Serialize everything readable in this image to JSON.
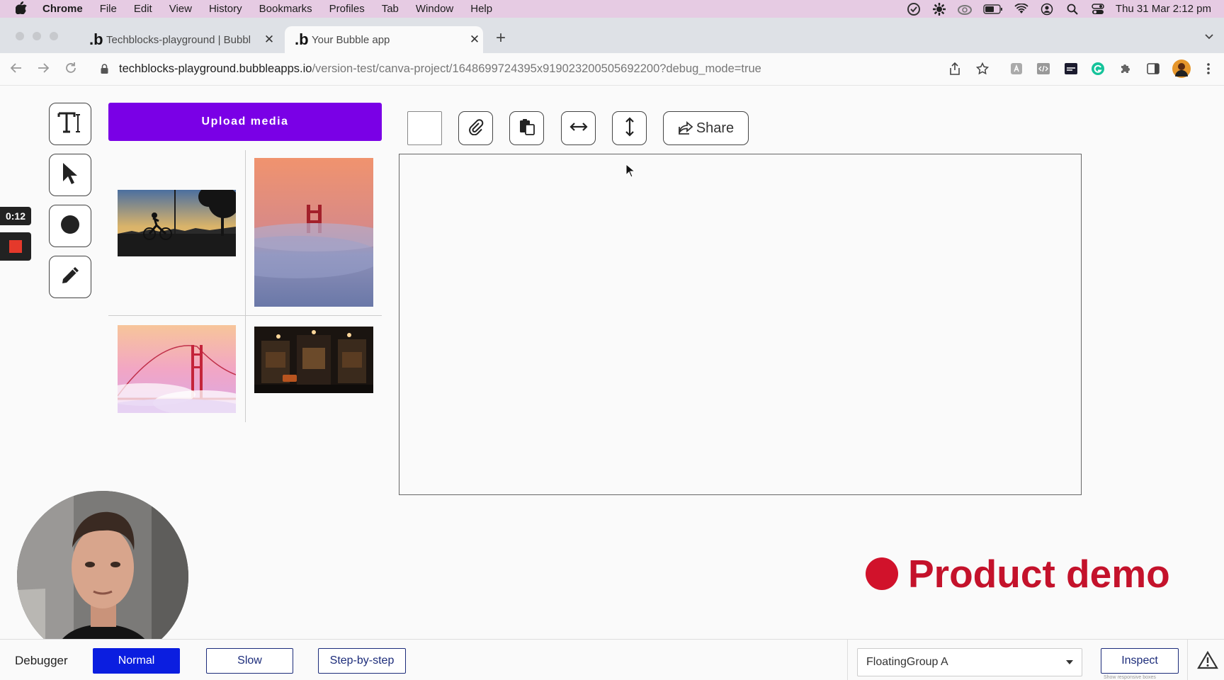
{
  "menubar": {
    "app_name": "Chrome",
    "items": [
      "File",
      "Edit",
      "View",
      "History",
      "Bookmarks",
      "Profiles",
      "Tab",
      "Window",
      "Help"
    ],
    "clock": "Thu 31 Mar  2:12 pm"
  },
  "browser": {
    "tabs": [
      {
        "title": "Techblocks-playground | Bubbl"
      },
      {
        "title": "Your Bubble app"
      }
    ],
    "url_host": "techblocks-playground.bubbleapps.io",
    "url_path": "/version-test/canva-project/1648699724395x919023200505692200?debug_mode=true"
  },
  "editor": {
    "upload_label": "Upload media",
    "share_label": "Share",
    "tools": [
      "text-tool",
      "select-tool",
      "circle-tool",
      "pen-tool"
    ]
  },
  "recorder": {
    "time": "0:12"
  },
  "overlay": {
    "product_demo": "Product demo"
  },
  "debugger": {
    "title": "Debugger",
    "modes": [
      "Normal",
      "Slow",
      "Step-by-step"
    ],
    "active_mode": "Normal",
    "element_select": "FloatingGroup A",
    "inspect_label": "Inspect",
    "inspect_sub": "Show responsive boxes"
  }
}
